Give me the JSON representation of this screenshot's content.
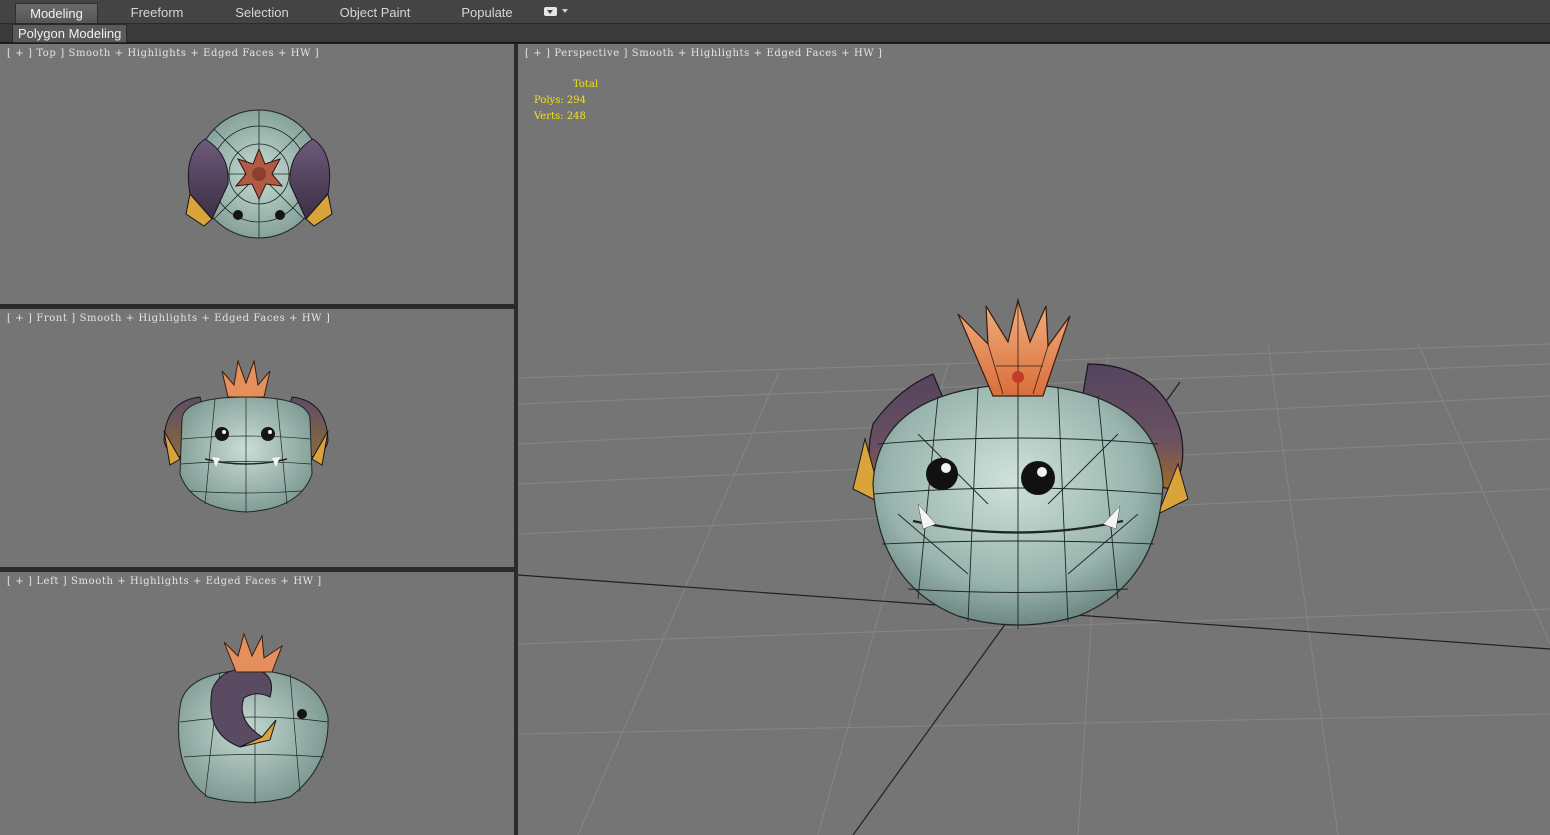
{
  "ribbon": {
    "tabs": [
      {
        "label": "Modeling",
        "active": true
      },
      {
        "label": "Freeform",
        "active": false
      },
      {
        "label": "Selection",
        "active": false
      },
      {
        "label": "Object Paint",
        "active": false
      },
      {
        "label": "Populate",
        "active": false
      }
    ],
    "panel_label": "Polygon Modeling"
  },
  "viewports": {
    "top": {
      "label": "[ + ] Top ] Smooth + Highlights + Edged Faces + HW ]"
    },
    "front": {
      "label": "[ + ] Front ] Smooth + Highlights + Edged Faces + HW ]"
    },
    "left": {
      "label": "[ + ] Left ] Smooth + Highlights + Edged Faces + HW ]"
    },
    "perspective": {
      "label": "[ + ] Perspective ] Smooth + Highlights + Edged Faces + HW ]",
      "stats": {
        "header": "Total",
        "polys_label": "Polys:",
        "polys_value": "294",
        "verts_label": "Verts:",
        "verts_value": "248"
      }
    }
  },
  "colors": {
    "viewport_bg": "#757575",
    "stats_text": "#f0e020",
    "body": "#a9c6bd",
    "horn": "#5a4a62",
    "horn_tip": "#d9a53a",
    "crown": "#e58f5c"
  }
}
